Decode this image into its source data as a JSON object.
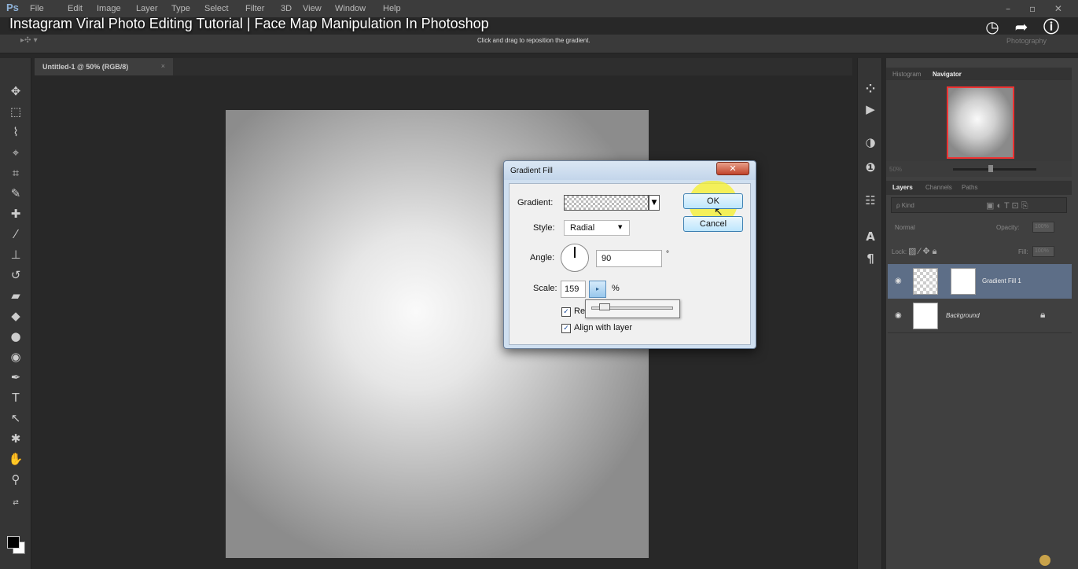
{
  "video": {
    "title": "Instagram Viral Photo Editing Tutorial | Face Map Manipulation In Photoshop"
  },
  "app": {
    "logo": "Ps",
    "menu": [
      "File",
      "Edit",
      "Image",
      "Layer",
      "Type",
      "Select",
      "Filter",
      "3D",
      "View",
      "Window",
      "Help"
    ]
  },
  "options_bar": {
    "hint": "Click and drag to reposition the gradient.",
    "workspace": "Photography"
  },
  "document": {
    "tab_label": "Untitled-1 @ 50% (RGB/8)",
    "tab_close": "×"
  },
  "panels": {
    "top_tabs": [
      "Histogram",
      "Navigator"
    ],
    "active_top_tab": "Navigator",
    "navigator_zoom": "50%",
    "layer_tabs": [
      "Layers",
      "Channels",
      "Paths"
    ],
    "filter_kind": "ρ Kind",
    "blend_mode": "Normal",
    "opacity_label": "Opacity:",
    "opacity_value": "100%",
    "lock_label": "Lock:",
    "fill_label": "Fill:",
    "fill_value": "100%",
    "layers": [
      {
        "name": "Gradient Fill 1",
        "selected": true
      },
      {
        "name": "Background",
        "locked": true
      }
    ]
  },
  "dialog": {
    "title": "Gradient Fill",
    "gradient_label": "Gradient:",
    "style_label": "Style:",
    "style_value": "Radial",
    "angle_label": "Angle:",
    "angle_value": "90",
    "angle_unit": "°",
    "scale_label": "Scale:",
    "scale_value": "159",
    "scale_unit": "%",
    "reverse_label": "Re",
    "align_label": "Align with layer",
    "ok_label": "OK",
    "cancel_label": "Cancel"
  },
  "colors": {
    "selected_layer": "#5d6e87",
    "dialog_frame": "#cfdff0",
    "highlight_glow": "#f6f028"
  }
}
